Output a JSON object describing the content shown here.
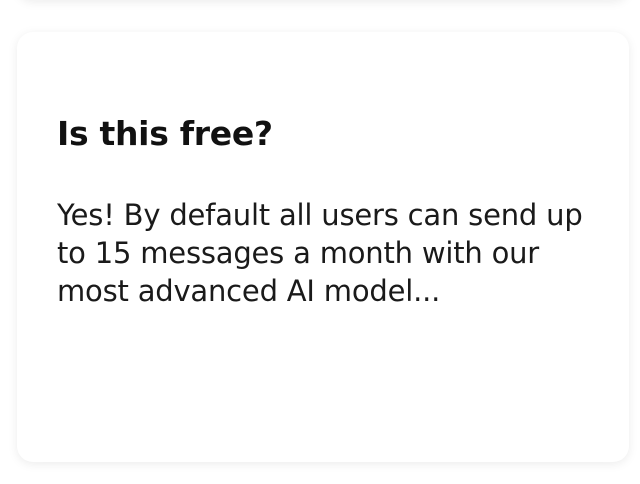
{
  "faq": {
    "question": "Is this free?",
    "answer": "Yes! By default all users can send up to 15 messages a month with our most advanced AI model..."
  }
}
